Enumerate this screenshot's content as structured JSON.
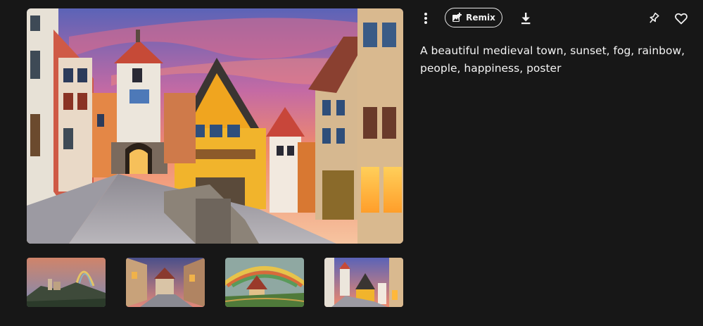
{
  "toolbar": {
    "more_icon": "more-vertical-icon",
    "remix_label": "Remix",
    "remix_icon": "image-plus-icon",
    "download_icon": "download-icon",
    "pin_icon": "pin-icon",
    "like_icon": "heart-icon"
  },
  "prompt": {
    "text": "A beautiful medieval town, sunset, fog, rainbow, people, happiness, poster"
  },
  "main_image": {
    "subject": "medieval town street at sunset with clock tower and half-timbered houses"
  },
  "thumbnails": [
    {
      "subject": "castle hill landscape with rainbow"
    },
    {
      "subject": "town street with half-timbered houses at dusk"
    },
    {
      "subject": "painted village with rainbow poster"
    },
    {
      "subject": "medieval town street with tower"
    }
  ],
  "colors": {
    "background": "#171717",
    "text": "#f2f2f2"
  }
}
